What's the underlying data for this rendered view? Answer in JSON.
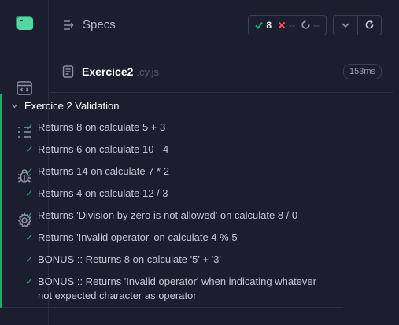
{
  "header": {
    "title": "Specs",
    "stats": {
      "passed": "8",
      "failed": "--",
      "pending": "--"
    }
  },
  "spec": {
    "file_name": "Exercice2",
    "file_ext": ".cy.js",
    "duration": "153ms"
  },
  "suite": {
    "title": "Exercice 2 Validation",
    "tests": [
      "Returns 8 on calculate 5 + 3",
      "Returns 6 on calculate 10 - 4",
      "Returns 14 on calculate 7 * 2",
      "Returns 4 on calculate 12 / 3",
      "Returns 'Division by zero is not allowed' on calculate 8 / 0",
      "Returns 'Invalid operator' on calculate 4 % 5",
      "BONUS :: Returns 8 on calculate '5' + '3'",
      "BONUS :: Returns 'Invalid operator' when indicating whatever not expected character as operator"
    ]
  },
  "icons": {
    "pass": "check-icon",
    "fail": "x-icon",
    "pending": "spinner-icon"
  },
  "colors": {
    "background": "#1b1e2e",
    "pass": "#1fa971",
    "fail": "#f15757",
    "border": "#2a2e41",
    "logo": "#3cbf8c"
  }
}
